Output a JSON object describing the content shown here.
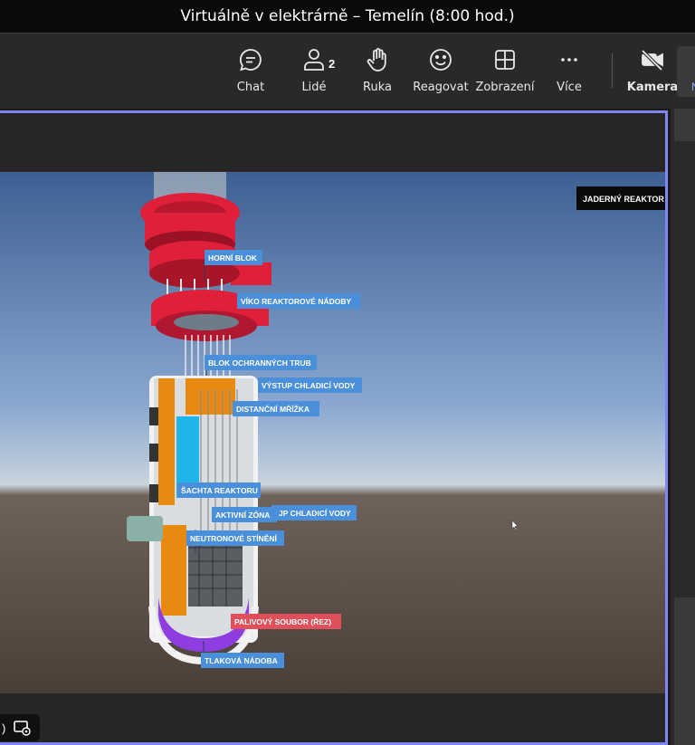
{
  "window": {
    "title": "Virtuálně v elektrárně – Temelín (8:00 hod.)"
  },
  "toolbar": {
    "chat": "Chat",
    "people": "Lidé",
    "people_count": "2",
    "raise_hand": "Ruka",
    "react": "Reagovat",
    "view": "Zobrazení",
    "more": "Více",
    "camera": "Kamera",
    "leave_partial": "N"
  },
  "shared_content": {
    "corner_tag": "JADERNÝ REAKTOR",
    "labels": {
      "upper_block": "HORNÍ BLOK",
      "vessel_lid": "VÍKO REAKTOROVÉ NÁDOBY",
      "guide_tube_block": "BLOK OCHRANNÝCH TRUB",
      "coolant_outlet": "VÝSTUP CHLADICÍ VODY",
      "spacer_grid": "DISTANČNÍ MŘÍŽKA",
      "reactor_shaft": "ŠACHTA REAKTORU",
      "active_zone": "AKTIVNÍ ZÓNA",
      "coolant_inlet": "JP CHLADICÍ VODY",
      "neutron_shield": "NEUTRONOVÉ STÍNĚNÍ",
      "fuel_assembly": "PALIVOVÝ SOUBOR (ŘEZ)",
      "pressure_vessel": "TLAKOVÁ NÁDOBA"
    }
  },
  "bottom_controls": {
    "partial_text": ")"
  },
  "colors": {
    "accent_border": "#7f85f5",
    "label_blue": "#4a8fd9",
    "label_red": "#e0505a",
    "reactor_red": "#e0203a"
  }
}
